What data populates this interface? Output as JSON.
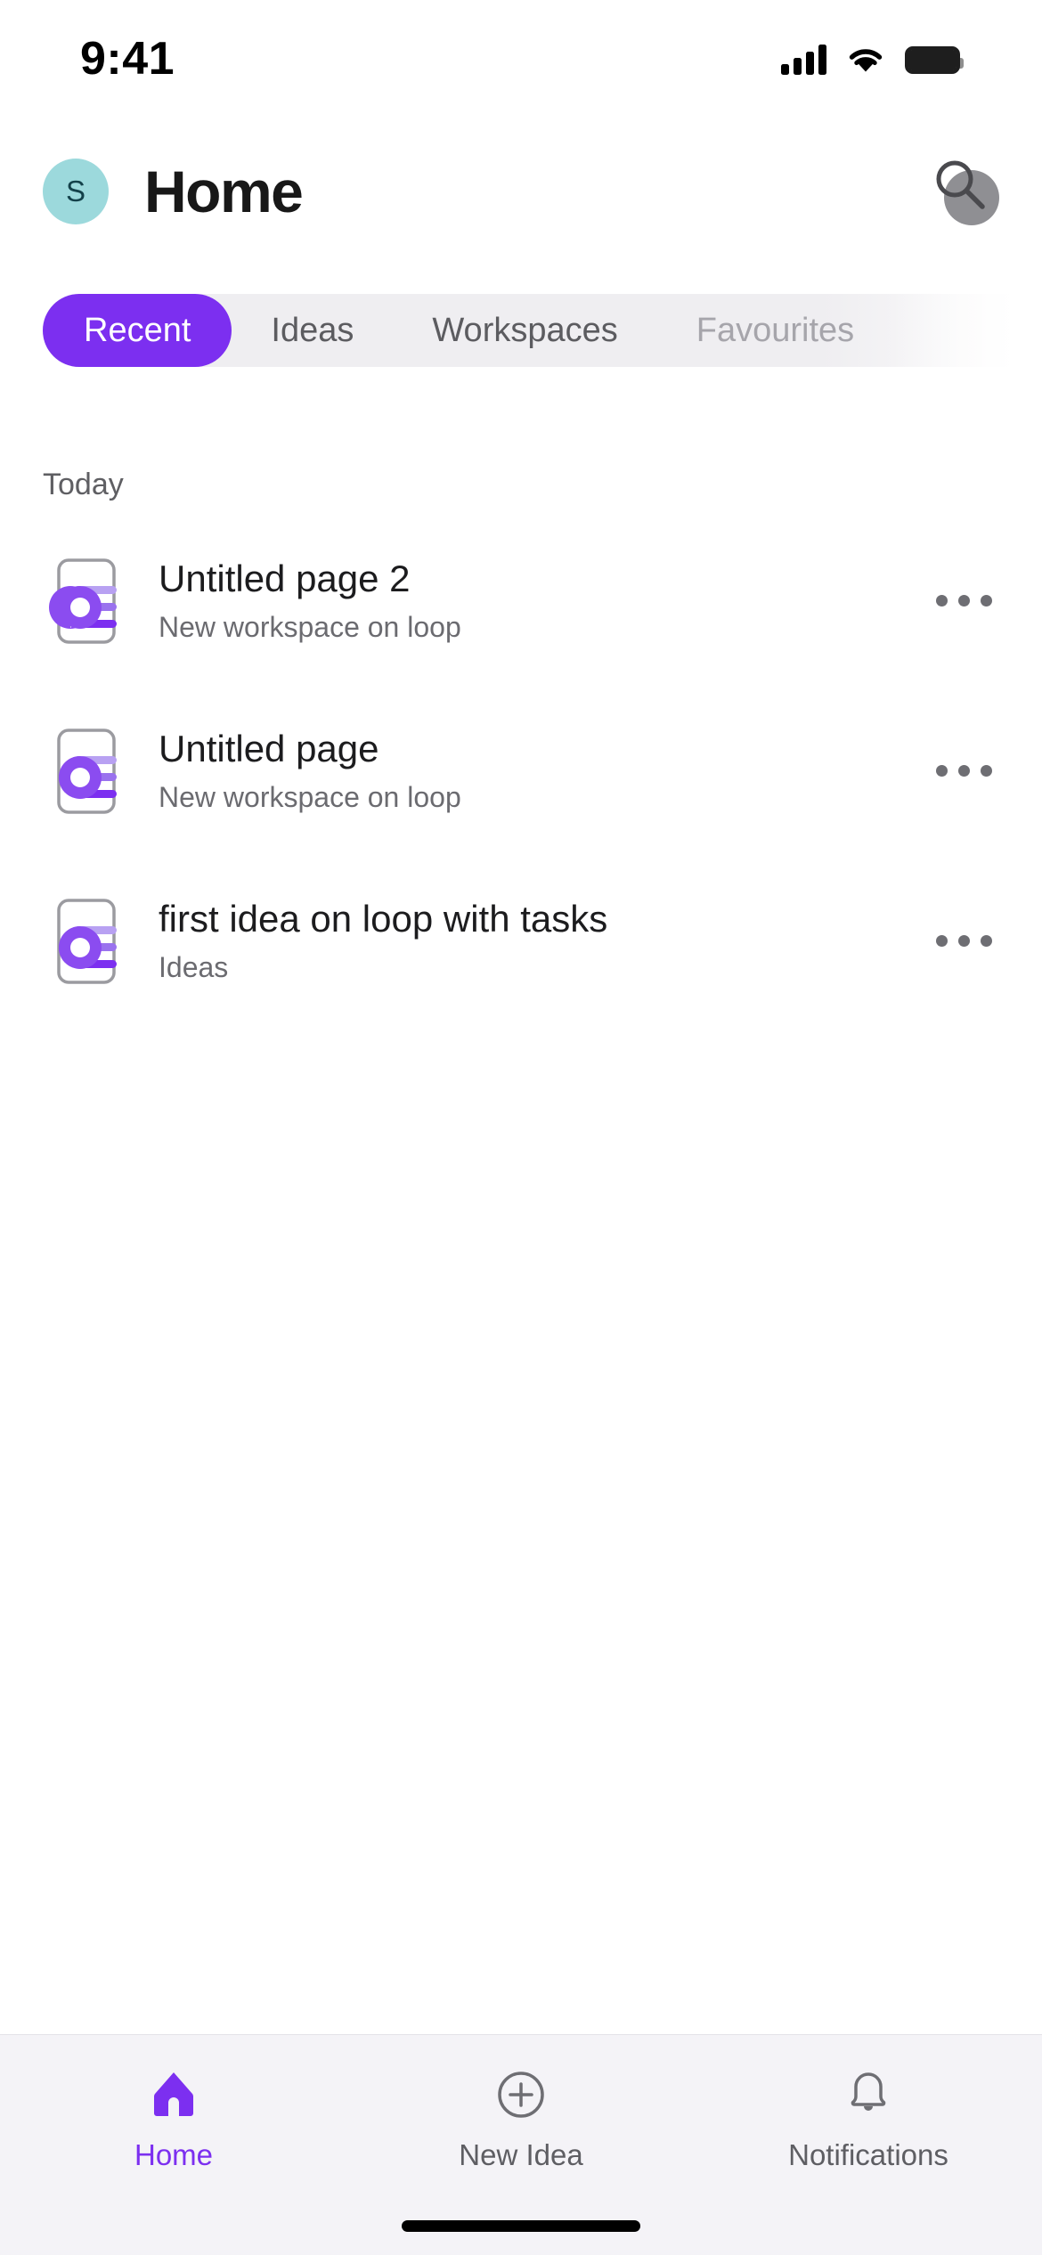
{
  "status_bar": {
    "time": "9:41",
    "cellular_icon": "cellular-bars-icon",
    "wifi_icon": "wifi-icon",
    "battery_icon": "battery-full-icon"
  },
  "header": {
    "avatar_initial": "S",
    "title": "Home",
    "search_icon": "search-icon"
  },
  "tabs": [
    {
      "label": "Recent",
      "active": true
    },
    {
      "label": "Ideas",
      "active": false
    },
    {
      "label": "Workspaces",
      "active": false
    },
    {
      "label": "Favourites",
      "active": false
    }
  ],
  "section": {
    "label": "Today"
  },
  "list": [
    {
      "icon": "loop-page-icon",
      "title": "Untitled page 2",
      "subtitle": "New workspace on loop",
      "more_icon": "more-horizontal-icon"
    },
    {
      "icon": "loop-page-icon",
      "title": "Untitled page",
      "subtitle": "New workspace on loop",
      "more_icon": "more-horizontal-icon"
    },
    {
      "icon": "loop-page-icon",
      "title": "first idea on loop with tasks",
      "subtitle": "Ideas",
      "more_icon": "more-horizontal-icon"
    }
  ],
  "bottom_nav": [
    {
      "label": "Home",
      "icon": "home-icon",
      "active": true
    },
    {
      "label": "New Idea",
      "icon": "plus-circle-icon",
      "active": false
    },
    {
      "label": "Notifications",
      "icon": "bell-icon",
      "active": false
    }
  ],
  "colors": {
    "accent_purple": "#7C2FF0",
    "avatar_teal": "#9CD9DC",
    "tabstrip_bg": "#EFEEF1",
    "bottom_nav_bg": "#F4F3F7",
    "title_text": "#181818",
    "secondary_text": "#6B6B70"
  }
}
